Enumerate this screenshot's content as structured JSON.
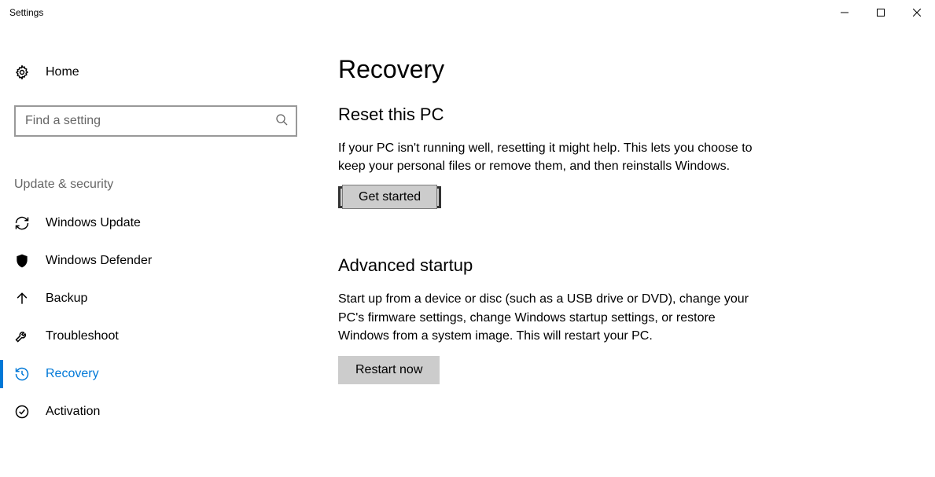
{
  "window": {
    "title": "Settings"
  },
  "sidebar": {
    "home": "Home",
    "search_placeholder": "Find a setting",
    "category": "Update & security",
    "items": [
      {
        "label": "Windows Update"
      },
      {
        "label": "Windows Defender"
      },
      {
        "label": "Backup"
      },
      {
        "label": "Troubleshoot"
      },
      {
        "label": "Recovery"
      },
      {
        "label": "Activation"
      }
    ]
  },
  "main": {
    "title": "Recovery",
    "reset": {
      "heading": "Reset this PC",
      "body": "If your PC isn't running well, resetting it might help. This lets you choose to keep your personal files or remove them, and then reinstalls Windows.",
      "button": "Get started"
    },
    "advanced": {
      "heading": "Advanced startup",
      "body": "Start up from a device or disc (such as a USB drive or DVD), change your PC's firmware settings, change Windows startup settings, or restore Windows from a system image. This will restart your PC.",
      "button": "Restart now"
    }
  }
}
